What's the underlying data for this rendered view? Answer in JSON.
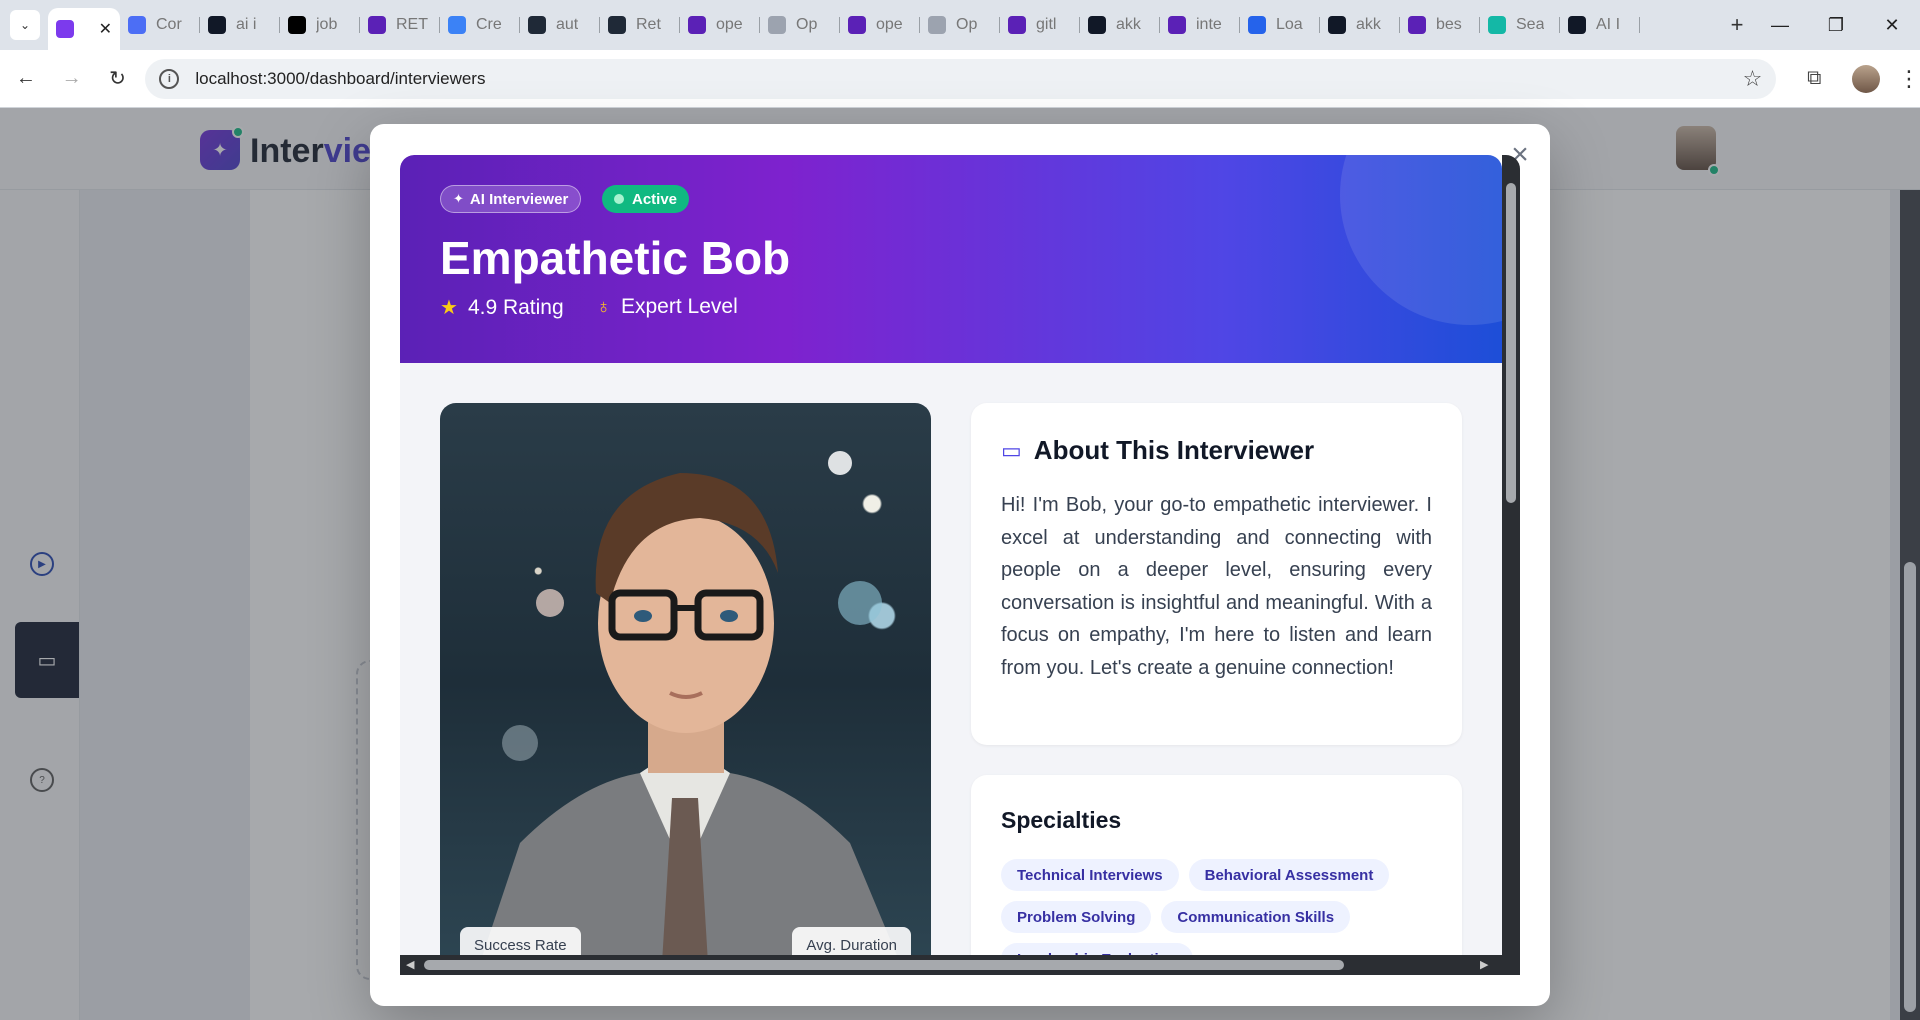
{
  "browser": {
    "tabs": [
      {
        "title": "",
        "color": "#7c3aed",
        "icon": "app-favicon",
        "active": true
      },
      {
        "title": "Cor",
        "color": "#4c6ef5",
        "icon": "c-favicon"
      },
      {
        "title": "ai i",
        "color": "#111827",
        "icon": "bolt-favicon"
      },
      {
        "title": "job",
        "color": "#000000",
        "icon": "triangle-favicon"
      },
      {
        "title": "RET",
        "color": "#5b21b6",
        "icon": "yahoo-favicon"
      },
      {
        "title": "Cre",
        "color": "#3b82f6",
        "icon": "dots-favicon"
      },
      {
        "title": "aut",
        "color": "#1f2937",
        "icon": "grid-favicon"
      },
      {
        "title": "Ret",
        "color": "#1f2937",
        "icon": "grid-favicon"
      },
      {
        "title": "ope",
        "color": "#5b21b6",
        "icon": "yahoo-favicon"
      },
      {
        "title": "Op",
        "color": "#9ca3af",
        "icon": "share-favicon"
      },
      {
        "title": "ope",
        "color": "#5b21b6",
        "icon": "yahoo-favicon"
      },
      {
        "title": "Op",
        "color": "#9ca3af",
        "icon": "share-favicon"
      },
      {
        "title": "gitl",
        "color": "#5b21b6",
        "icon": "yahoo-favicon"
      },
      {
        "title": "akk",
        "color": "#111827",
        "icon": "github-favicon"
      },
      {
        "title": "inte",
        "color": "#5b21b6",
        "icon": "yahoo-favicon"
      },
      {
        "title": "Loa",
        "color": "#2563eb",
        "icon": "doc-favicon"
      },
      {
        "title": "akk",
        "color": "#111827",
        "icon": "github-favicon"
      },
      {
        "title": "bes",
        "color": "#5b21b6",
        "icon": "yahoo-favicon"
      },
      {
        "title": "Sea",
        "color": "#14b8a6",
        "icon": "v-favicon"
      },
      {
        "title": "AI I",
        "color": "#111827",
        "icon": "dice-favicon"
      }
    ],
    "url": "localhost:3000/dashboard/interviewers"
  },
  "app": {
    "logo_prefix": "Inter",
    "logo_accent": "view"
  },
  "modal": {
    "badge_ai": "AI Interviewer",
    "badge_status": "Active",
    "name": "Empathetic Bob",
    "rating": "4.9 Rating",
    "level": "Expert Level",
    "about_title": "About This Interviewer",
    "about_text": "Hi! I'm Bob, your go-to empathetic interviewer. I excel at understanding and connecting with people on a deeper level, ensuring every conversation is insightful and meaningful. With a focus on empathy, I'm here to listen and learn from you. Let's create a genuine connection!",
    "specialties_title": "Specialties",
    "specialties": [
      "Technical Interviews",
      "Behavioral Assessment",
      "Problem Solving",
      "Communication Skills",
      "Leadership Evaluation"
    ],
    "stat_success": "Success Rate",
    "stat_duration": "Avg. Duration"
  },
  "colors": {
    "brand": "#4f46e5",
    "active_green": "#10b981",
    "hero_gradient_start": "#5b21b6",
    "hero_gradient_end": "#1d4ed8"
  }
}
